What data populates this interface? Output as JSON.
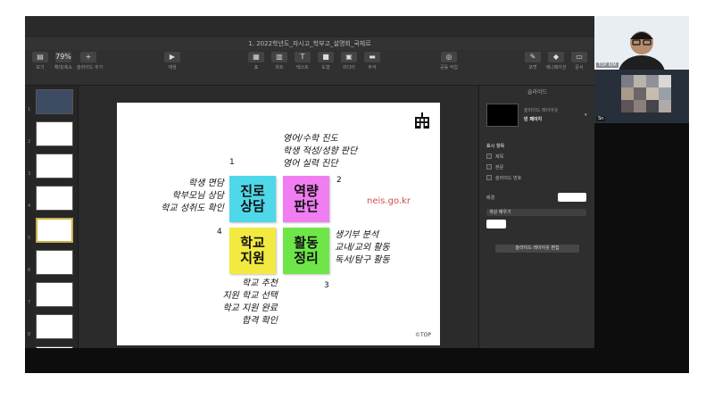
{
  "window": {
    "title": "1. 2022학년도_자시고_학부고_설명회_국체르"
  },
  "toolbar": {
    "items": [
      {
        "label": "보기",
        "icon": "sidebar-icon"
      },
      {
        "label": "확대/축소",
        "value": "79%",
        "icon": "zoom-icon"
      },
      {
        "label": "슬라이드 추가",
        "icon": "plus-icon"
      },
      {
        "label": "재생",
        "icon": "play-icon"
      },
      {
        "label": "표",
        "icon": "table-icon"
      },
      {
        "label": "차트",
        "icon": "chart-icon"
      },
      {
        "label": "텍스트",
        "icon": "text-icon"
      },
      {
        "label": "도형",
        "icon": "shape-icon"
      },
      {
        "label": "미디어",
        "icon": "media-icon"
      },
      {
        "label": "주석",
        "icon": "comment-icon"
      },
      {
        "label": "공동 작업",
        "icon": "collab-icon"
      },
      {
        "label": "포맷",
        "icon": "format-icon"
      },
      {
        "label": "애니메이션",
        "icon": "animate-icon"
      },
      {
        "label": "문서",
        "icon": "document-icon"
      }
    ]
  },
  "thumbnails": [
    "1",
    "2",
    "3",
    "4",
    "5",
    "6",
    "7",
    "8",
    "9"
  ],
  "slide": {
    "cards": [
      {
        "text": "진로\n상담",
        "color": "#4fd8ea"
      },
      {
        "text": "역량\n판단",
        "color": "#f07ef2"
      },
      {
        "text": "학교\n지원",
        "color": "#f2ea40"
      },
      {
        "text": "활동\n정리",
        "color": "#6ee64a"
      }
    ],
    "numbers": [
      "1",
      "2",
      "3",
      "4"
    ],
    "notes_top": [
      "영어/수학 진도",
      "학생 적성/성향 판단",
      "영어 실력 진단"
    ],
    "notes_left": [
      "학생 면담",
      "학부모님 상담",
      "학교 성취도 확인"
    ],
    "notes_right": [
      "생기부 분석",
      "교내/교외 활동",
      "독서/탐구 활동"
    ],
    "notes_bottom": [
      "학교 추천",
      "지원 학교 선택",
      "학교 지원 완료",
      "합격 확인"
    ],
    "link": "neis.go.kr",
    "copyright": "©TOP"
  },
  "inspector": {
    "title": "슬라이드",
    "layout_label": "슬라이드 레이아웃",
    "layout_value": "빈 페이지",
    "display_items_header": "표시 항목",
    "display_items": [
      "제목",
      "본문",
      "슬라이드 번호"
    ],
    "background_label": "배경",
    "fill_option": "색상 채우기",
    "edit_layout_button": "슬라이드 레이아웃 편집"
  },
  "participants": [
    {
      "name": "TOP KIM"
    },
    {
      "name": "Sn"
    }
  ]
}
